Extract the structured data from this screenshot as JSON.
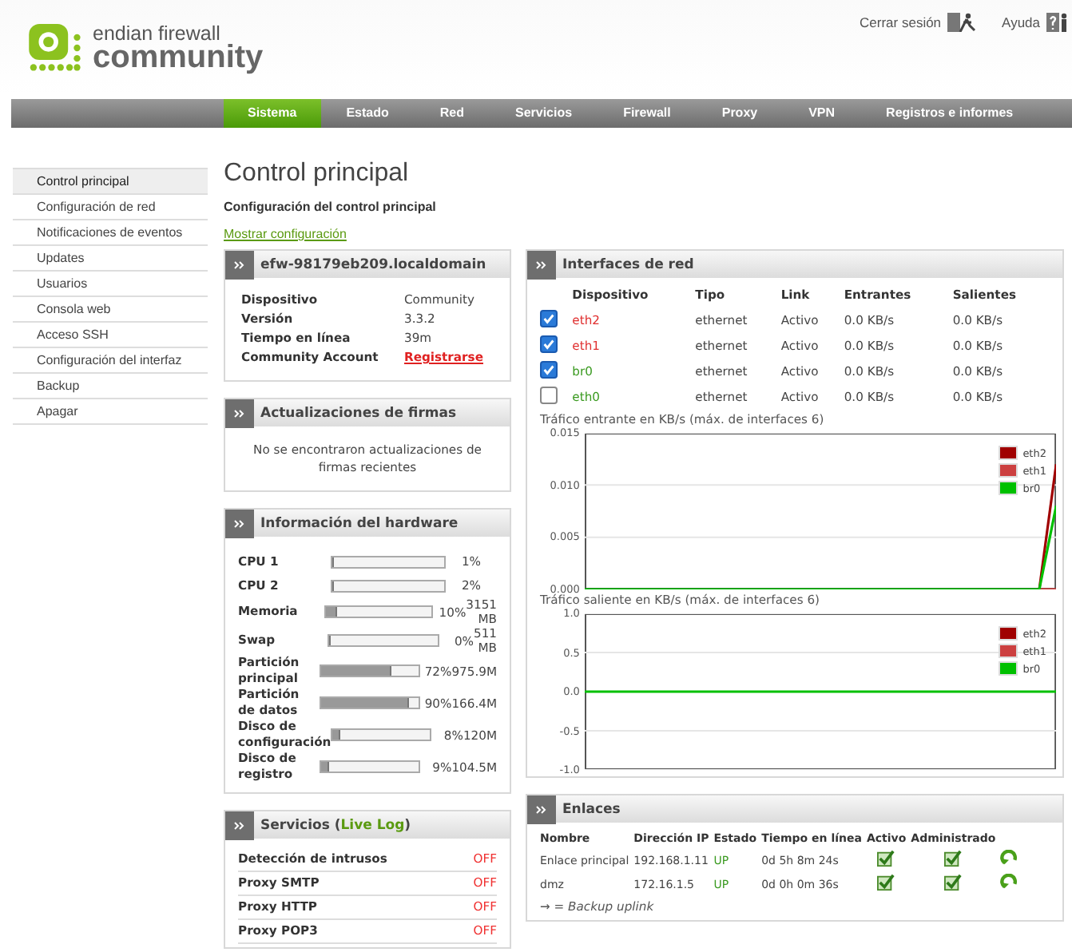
{
  "logo": {
    "line1": "endian firewall",
    "line2": "community"
  },
  "top_links": [
    {
      "label": "Cerrar sesión",
      "kind": "logout"
    },
    {
      "label": "Ayuda",
      "kind": "help"
    }
  ],
  "nav": [
    {
      "label": "Sistema",
      "selected": true
    },
    {
      "label": "Estado",
      "selected": false
    },
    {
      "label": "Red",
      "selected": false
    },
    {
      "label": "Servicios",
      "selected": false
    },
    {
      "label": "Firewall",
      "selected": false
    },
    {
      "label": "Proxy",
      "selected": false
    },
    {
      "label": "VPN",
      "selected": false
    },
    {
      "label": "Registros e informes",
      "selected": false
    }
  ],
  "sidebar": [
    {
      "label": "Control principal",
      "selected": true
    },
    {
      "label": "Configuración de red",
      "selected": false
    },
    {
      "label": "Notificaciones de eventos",
      "selected": false
    },
    {
      "label": "Updates",
      "selected": false
    },
    {
      "label": "Usuarios",
      "selected": false
    },
    {
      "label": "Consola web",
      "selected": false
    },
    {
      "label": "Acceso SSH",
      "selected": false
    },
    {
      "label": "Configuración del interfaz",
      "selected": false
    },
    {
      "label": "Backup",
      "selected": false
    },
    {
      "label": "Apagar",
      "selected": false
    }
  ],
  "page": {
    "title": "Control principal",
    "subtitle": "Configuración del control principal",
    "link": "Mostrar configuración"
  },
  "system_panel": {
    "title": "efw-98179eb209.localdomain",
    "rows": [
      {
        "label": "Dispositivo",
        "value": "Community",
        "kind": "text"
      },
      {
        "label": "Versión",
        "value": "3.3.2",
        "kind": "text"
      },
      {
        "label": "Tiempo en línea",
        "value": "39m",
        "kind": "text"
      },
      {
        "label": "Community Account",
        "value": "Registrarse",
        "kind": "link"
      }
    ]
  },
  "updates_panel": {
    "title": "Actualizaciones de firmas",
    "message": "No se encontraron actualizaciones de firmas recientes"
  },
  "hardware_panel": {
    "title": "Información del hardware",
    "rows": [
      {
        "label": "CPU 1",
        "level": 0.01,
        "percent": "1%"
      },
      {
        "label": "CPU 2",
        "level": 0.02,
        "percent": "2%"
      },
      {
        "label": "Memoria",
        "level": 0.1,
        "percent": "10%",
        "size": "3151 MB"
      },
      {
        "label": "Swap",
        "level": 0.0,
        "percent": "0%",
        "size": "511 MB"
      },
      {
        "label": "Partición principal",
        "level": 0.72,
        "percent": "72%",
        "size": "975.9M"
      },
      {
        "label": "Partición de datos",
        "level": 0.9,
        "percent": "90%",
        "size": "166.4M"
      },
      {
        "label": "Disco de configuración",
        "level": 0.08,
        "percent": "8%",
        "size": "120M"
      },
      {
        "label": "Disco de registro",
        "level": 0.09,
        "percent": "9%",
        "size": "104.5M"
      }
    ]
  },
  "services_panel": {
    "title_before": "Servicios (",
    "link": "Live Log",
    "title_after": ")",
    "rows": [
      {
        "label": "Detección de intrusos",
        "status": "OFF"
      },
      {
        "label": "Proxy SMTP",
        "status": "OFF"
      },
      {
        "label": "Proxy HTTP",
        "status": "OFF"
      },
      {
        "label": "Proxy POP3",
        "status": "OFF"
      }
    ]
  },
  "interfaces_panel": {
    "title": "Interfaces de red",
    "columns": [
      "Dispositivo",
      "Tipo",
      "Link",
      "Entrantes",
      "Salientes"
    ],
    "rows": [
      {
        "checked": true,
        "device": "eth2",
        "color": "#e03030",
        "type": "ethernet",
        "link": "Activo",
        "in": "0.0 KB/s",
        "out": "0.0 KB/s"
      },
      {
        "checked": true,
        "device": "eth1",
        "color": "#e03030",
        "type": "ethernet",
        "link": "Activo",
        "in": "0.0 KB/s",
        "out": "0.0 KB/s"
      },
      {
        "checked": true,
        "device": "br0",
        "color": "#3a9a20",
        "type": "ethernet",
        "link": "Activo",
        "in": "0.0 KB/s",
        "out": "0.0 KB/s"
      },
      {
        "checked": false,
        "device": "eth0",
        "color": "#3a9a20",
        "type": "ethernet",
        "link": "Activo",
        "in": "0.0 KB/s",
        "out": "0.0 KB/s"
      }
    ],
    "charts": [
      {
        "chart_data": {
          "type": "line",
          "title": "Tráfico entrante en KB/s (máx. de interfaces 6)",
          "legend": true,
          "ylim": [
            0,
            0.015
          ],
          "yticks": [
            {
              "value": 0,
              "label": "0.000"
            },
            {
              "value": 0.005,
              "label": "0.005"
            },
            {
              "value": 0.01,
              "label": "0.010"
            },
            {
              "value": 0.015,
              "label": "0.015"
            }
          ],
          "series": [
            {
              "name": "eth2",
              "color": "#a00000",
              "values": [
                null,
                null,
                null,
                null,
                null,
                null,
                null,
                null,
                null,
                null,
                null,
                null,
                null,
                null,
                null,
                null,
                null,
                null,
                null,
                null,
                null,
                null,
                null,
                null,
                null,
                null,
                null,
                0,
                0.012
              ]
            },
            {
              "name": "eth1",
              "color": "#cc4040",
              "values": [
                null,
                null,
                null,
                null,
                null,
                null,
                null,
                null,
                null,
                null,
                null,
                null,
                null,
                null,
                null,
                null,
                null,
                null,
                null,
                null,
                null,
                null,
                null,
                null,
                null,
                null,
                null,
                0,
                0
              ]
            },
            {
              "name": "br0",
              "color": "#00c000",
              "values": [
                0,
                0,
                0,
                0,
                0,
                0,
                0,
                0,
                0,
                0,
                0,
                0,
                0,
                0,
                0,
                0,
                0,
                0,
                0,
                0,
                0,
                0,
                0,
                0,
                0,
                0,
                0,
                0,
                0.008
              ]
            }
          ]
        }
      },
      {
        "chart_data": {
          "type": "line",
          "title": "Tráfico saliente en KB/s (máx. de interfaces 6)",
          "legend": true,
          "ylim": [
            -1,
            1
          ],
          "yticks": [
            {
              "value": -1,
              "label": "-1.0"
            },
            {
              "value": -0.5,
              "label": "-0.5"
            },
            {
              "value": 0,
              "label": "0.0"
            },
            {
              "value": 0.5,
              "label": "0.5"
            },
            {
              "value": 1,
              "label": "1.0"
            }
          ],
          "series": [
            {
              "name": "eth2",
              "color": "#a00000",
              "values": [
                null,
                null,
                null,
                null,
                null,
                null,
                null,
                null,
                null,
                null,
                null,
                null,
                null,
                null,
                null,
                null,
                null,
                null,
                null,
                null,
                null,
                null,
                null,
                null,
                null,
                null,
                null,
                null,
                null
              ]
            },
            {
              "name": "eth1",
              "color": "#cc4040",
              "values": [
                null,
                null,
                null,
                null,
                null,
                null,
                null,
                null,
                null,
                null,
                null,
                null,
                null,
                null,
                null,
                null,
                null,
                null,
                null,
                null,
                null,
                null,
                null,
                null,
                null,
                null,
                null,
                null,
                null
              ]
            },
            {
              "name": "br0",
              "color": "#00c000",
              "values": [
                0,
                0,
                0,
                0,
                0,
                0,
                0,
                0,
                0,
                0,
                0,
                0,
                0,
                0,
                0,
                0,
                0,
                0,
                0,
                0,
                0,
                0,
                0,
                0,
                0,
                0,
                0,
                0,
                0
              ]
            }
          ]
        }
      }
    ]
  },
  "links_panel": {
    "title": "Enlaces",
    "columns": [
      "Nombre",
      "Dirección IP",
      "Estado",
      "Tiempo en línea",
      "Activo",
      "Administrado"
    ],
    "rows": [
      {
        "name": "Enlace principal",
        "ip": "192.168.1.11",
        "status": "UP",
        "uptime": "0d 5h 8m 24s",
        "active": true,
        "managed": true
      },
      {
        "name": "dmz",
        "ip": "172.16.1.5",
        "status": "UP",
        "uptime": "0d 0h 0m 36s",
        "active": true,
        "managed": true
      }
    ],
    "legend": "→ = Backup uplink"
  }
}
